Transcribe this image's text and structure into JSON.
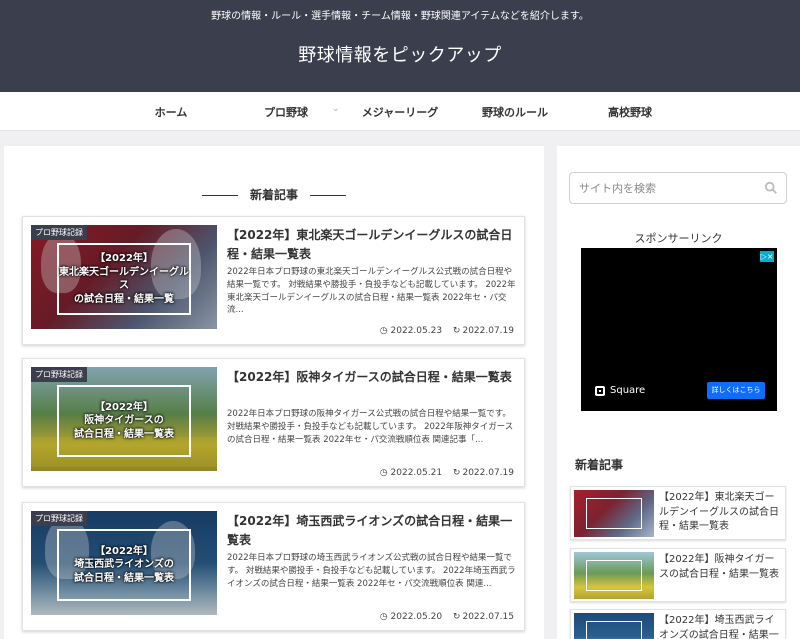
{
  "header": {
    "tagline": "野球の情報・ルール・選手情報・チーム情報・野球関連アイテムなどを紹介します。",
    "site_title": "野球情報をピックアップ"
  },
  "nav": {
    "items": [
      "ホーム",
      "プロ野球",
      "メジャーリーグ",
      "野球のルール",
      "高校野球"
    ]
  },
  "main": {
    "section_title": "新着記事",
    "articles": [
      {
        "category": "プロ野球記録",
        "thumb_text": "【2022年】\n東北楽天ゴールデンイーグルス\nの試合日程・結果一覧",
        "title": "【2022年】東北楽天ゴールデンイーグルスの試合日程・結果一覧表",
        "excerpt": "2022年日本プロ野球の東北楽天ゴールデンイーグルス公式戦の試合日程や結果一覧です。 対戦結果や勝投手・負投手なども記載しています。 2022年東北楽天ゴールデンイーグルスの試合日程・結果一覧表 2022年セ・パ交流...",
        "published": "2022.05.23",
        "updated": "2022.07.19"
      },
      {
        "category": "プロ野球記録",
        "thumb_text": "【2022年】\n阪神タイガースの\n試合日程・結果一覧表",
        "title": "【2022年】阪神タイガースの試合日程・結果一覧表",
        "excerpt": "2022年日本プロ野球の阪神タイガース公式戦の試合日程や結果一覧です。 対戦結果や勝投手・負投手なども記載しています。 2022年阪神タイガースの試合日程・結果一覧表 2022年セ・パ交流戦順位表 関連記事「...",
        "published": "2022.05.21",
        "updated": "2022.07.19"
      },
      {
        "category": "プロ野球記録",
        "thumb_text": "【2022年】\n埼玉西武ライオンズの\n試合日程・結果一覧表",
        "title": "【2022年】埼玉西武ライオンズの試合日程・結果一覧表",
        "excerpt": "2022年日本プロ野球の埼玉西武ライオンズ公式戦の試合日程や結果一覧です。 対戦結果や勝投手・負投手なども記載しています。 2022年埼玉西武ライオンズの試合日程・結果一覧表 2022年セ・パ交流戦順位表 関連...",
        "published": "2022.05.20",
        "updated": "2022.07.15"
      }
    ]
  },
  "sidebar": {
    "search_placeholder": "サイト内を検索",
    "sponsor_label": "スポンサーリンク",
    "ad": {
      "brand": "Square",
      "button": "詳しくはこちら",
      "badge": "▷×"
    },
    "recent_title": "新着記事",
    "recent": [
      {
        "title": "【2022年】東北楽天ゴールデンイーグルスの試合日程・結果一覧表"
      },
      {
        "title": "【2022年】阪神タイガースの試合日程・結果一覧表"
      },
      {
        "title": "【2022年】埼玉西武ライオンズの試合日程・結果一"
      }
    ]
  },
  "colors": {
    "header_bg": "#3b3e4c",
    "ad_button": "#0d6efd"
  }
}
